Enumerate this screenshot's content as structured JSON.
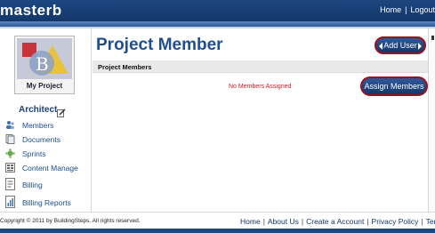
{
  "header": {
    "brand": "masterb",
    "links": [
      "Home",
      "Logout"
    ]
  },
  "sidebar": {
    "project_name": "My Project",
    "role": "Architect",
    "items": [
      {
        "label": "Members",
        "icon": "members-icon"
      },
      {
        "label": "Documents",
        "icon": "documents-icon"
      },
      {
        "label": "Sprints",
        "icon": "sprints-icon"
      },
      {
        "label": "Content Manage",
        "icon": "content-manage-icon"
      },
      {
        "label": "Billing",
        "icon": "billing-icon"
      },
      {
        "label": "Billing Reports",
        "icon": "billing-reports-icon"
      }
    ]
  },
  "main": {
    "title": "Project Member",
    "add_user_label": "Add User",
    "panel_header": "Project Members",
    "empty_message": "No Members Assigned",
    "assign_members_label": "Assign Members"
  },
  "footer": {
    "copyright": "Copyright © 2011 by BuildingSteps. All rights reserved.",
    "links": [
      "Home",
      "About Us",
      "Create a Account",
      "Privacy Policy",
      "Term"
    ]
  },
  "colors": {
    "header_bg": "#1d4780",
    "title_blue": "#1f4f8e",
    "highlight_red": "#a00e17",
    "empty_text_red": "#e0141b"
  }
}
